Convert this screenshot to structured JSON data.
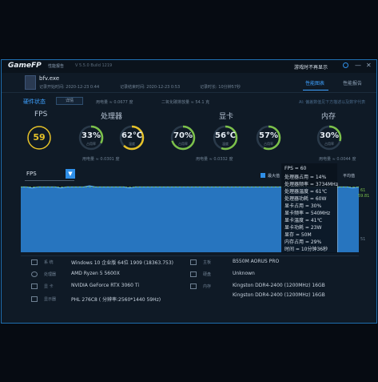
{
  "titlebar": {
    "logo": "GameFP",
    "tab": "性能报告",
    "version": "V 5.5.0 Build 1219",
    "right_text": "游戏时不再显示",
    "close": "✕",
    "minimize": "—"
  },
  "app": {
    "exe": "bfv.exe",
    "start_time": "记录开始时间: 2020-12-23 0:44",
    "end_time": "记录结束时间: 2020-12-23 0:53",
    "duration": "记录时长: 10分钟57秒",
    "tab_active": "性能图表",
    "tab_other": "性能报告"
  },
  "status_row": {
    "label": "硬件状态",
    "button": "详情",
    "power": "用电量 ≈ 0.0677 度",
    "co2": "二氧化碳排放量 ≈ 54.1 克",
    "hint": "AI: 偏差数值见下方描述以及数字代表"
  },
  "gauges": {
    "fps": {
      "title": "FPS",
      "value": "59"
    },
    "cpu": {
      "title": "处理器",
      "usage": "33%",
      "usage_sub": "占用率",
      "temp": "62℃",
      "temp_sub": "温度",
      "power": "用电量 ≈ 0.0301 度"
    },
    "gpu": {
      "title": "显卡",
      "usage": "70%",
      "usage_sub": "占用率",
      "temp": "56℃",
      "temp_sub": "温度",
      "extra": "57%",
      "extra_sub": "占用率",
      "power": "用电量 ≈ 0.0332 度"
    },
    "mem": {
      "title": "内存",
      "usage": "30%",
      "usage_sub": "占用率",
      "power": "用电量 ≈ 0.0044 度"
    }
  },
  "chart_controls": {
    "select_value": "FPS",
    "select_arrow": "▼",
    "legend": "最大值",
    "avg_label": "平均值",
    "y_top": "61",
    "y_mid": "59.81",
    "y_bottom": "51"
  },
  "chart_data": {
    "type": "area",
    "series": [
      {
        "values": [
          60,
          60,
          59,
          60,
          60,
          60,
          60,
          59,
          60,
          60,
          60,
          60,
          61,
          60,
          60,
          60,
          60,
          60,
          60,
          59,
          60,
          60,
          60,
          60,
          60,
          60,
          60,
          60,
          60,
          60,
          60,
          60,
          60,
          60,
          60,
          60,
          60,
          60,
          60,
          60,
          60,
          60,
          60,
          60,
          60,
          60,
          60,
          60,
          60,
          60,
          60,
          60,
          60,
          60,
          60,
          60,
          60,
          60,
          59,
          60
        ]
      }
    ],
    "y_range": [
      0,
      61
    ],
    "grid": false
  },
  "tooltip": {
    "lines": [
      "FPS = 60",
      "处理器占用 = 14%",
      "处理器频率 = 3734MHz",
      "处理器温度 = 61℃",
      "处理器功耗 = 60W",
      "显卡占用 = 30%",
      "显卡频率 = 540MHz",
      "显卡温度 = 41℃",
      "显卡功耗 = 23W",
      "显存 = 50M",
      "内存占用 = 29%",
      "时间 = 10分钟36秒"
    ]
  },
  "info": {
    "os_label": "系  统",
    "os_value": "Windows 10 企业版 64位  1909 (18363.753)",
    "cpu_label": "处理器",
    "cpu_value": "AMD Ryzen 5 5600X",
    "gpu_label": "显  卡",
    "gpu_value": "NVIDIA GeForce RTX 3060 Ti",
    "mon_label": "显示器",
    "mon_value": "PHL 276C8 ( 分辨率:2560*1440 59Hz)",
    "mb_label": "主板",
    "mb_value": "B550M AORUS PRO",
    "disk_label": "硬盘",
    "disk_value": "Unknown",
    "mem_label": "内存",
    "mem_value1": "Kingston DDR4-2400 (1200MHz) 16GB",
    "mem_value2": "Kingston DDR4-2400 (1200MHz) 16GB"
  },
  "colors": {
    "accent": "#2f8fe8",
    "fps_ring": "#e6c229",
    "ok_ring": "#7cc14a"
  }
}
